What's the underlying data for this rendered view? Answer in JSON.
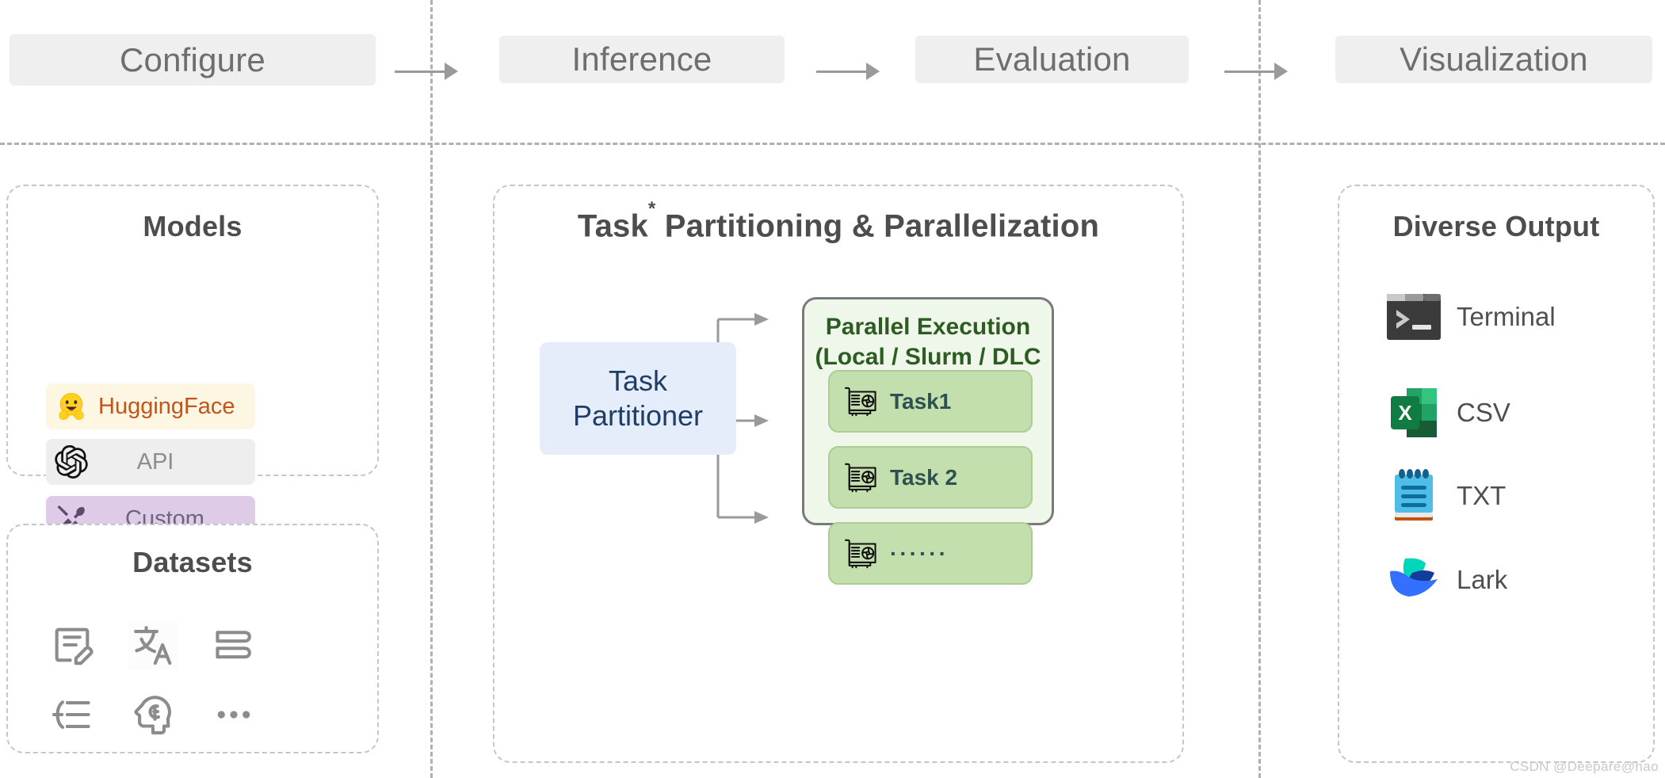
{
  "pipeline": {
    "stages": [
      {
        "label": "Configure"
      },
      {
        "label": "Inference"
      },
      {
        "label": "Evaluation"
      },
      {
        "label": "Visualization"
      }
    ]
  },
  "models_panel": {
    "title": "Models",
    "items": [
      {
        "label": "HuggingFace",
        "icon": "hugging-face-icon",
        "bg": "#fdf6e3",
        "text_color": "#c4541a"
      },
      {
        "label": "API",
        "icon": "openai-icon",
        "bg": "#eeeeee",
        "text_color": "#8d8d8d"
      },
      {
        "label": "Custom",
        "icon": "tools-icon",
        "bg": "#ddcbe8",
        "text_color": "#6e6480"
      }
    ]
  },
  "datasets_panel": {
    "title": "Datasets",
    "icons": [
      "document-edit-icon",
      "translate-icon",
      "book-icon",
      "list-indent-icon",
      "brain-head-icon",
      "ellipsis-icon"
    ]
  },
  "center_panel": {
    "title_main": "Task",
    "title_sup": "*",
    "title_rest": " Partitioning & Parallelization",
    "partitioner": {
      "line1": "Task",
      "line2": "Partitioner"
    },
    "parallel_execution": {
      "title_line1": "Parallel Execution",
      "title_line2": "(Local / Slurm / DLC ⋯)",
      "tasks": [
        {
          "label": "Task1",
          "icon": "gpu-card-icon"
        },
        {
          "label": "Task 2",
          "icon": "gpu-card-icon"
        },
        {
          "label": "······",
          "icon": "gpu-card-icon"
        }
      ]
    }
  },
  "output_panel": {
    "title": "Diverse Output",
    "items": [
      {
        "label": "Terminal",
        "icon": "terminal-icon"
      },
      {
        "label": "CSV",
        "icon": "excel-icon"
      },
      {
        "label": "TXT",
        "icon": "notepad-icon"
      },
      {
        "label": "Lark",
        "icon": "lark-icon"
      }
    ]
  },
  "watermark": {
    "text": "CSDN @Deepare@hao"
  },
  "colors": {
    "stage_bg": "#efefef",
    "stage_text": "#6e6e6e",
    "divider": "#b0b0b0",
    "panel_border": "#c6c6c6",
    "partitioner_bg": "#e4edf9",
    "partitioner_text": "#1f3d66",
    "parallel_bg": "#eff7ea",
    "parallel_text": "#2c5c21",
    "task_bg": "#c3dfae",
    "task_text": "#2c5150",
    "huggingface_text": "#c4541a"
  }
}
